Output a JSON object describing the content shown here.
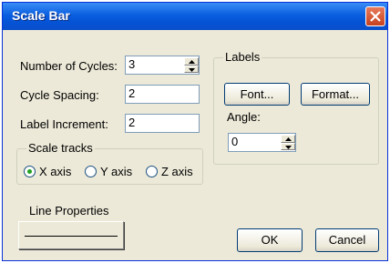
{
  "window": {
    "title": "Scale Bar"
  },
  "fields": {
    "cycles": {
      "label": "Number of Cycles:",
      "value": "3"
    },
    "spacing": {
      "label": "Cycle Spacing:",
      "value": "2"
    },
    "increment": {
      "label": "Label Increment:",
      "value": "2"
    }
  },
  "scale_tracks": {
    "legend": "Scale tracks",
    "options": [
      "X axis",
      "Y axis",
      "Z axis"
    ],
    "selected": "X axis"
  },
  "labels": {
    "legend": "Labels",
    "font_button": "Font...",
    "format_button": "Format...",
    "angle_label": "Angle:",
    "angle_value": "0"
  },
  "line_properties": {
    "label": "Line Properties"
  },
  "buttons": {
    "ok": "OK",
    "cancel": "Cancel"
  },
  "icons": {
    "close": "close-icon",
    "up": "spin-up-icon",
    "down": "spin-down-icon"
  }
}
